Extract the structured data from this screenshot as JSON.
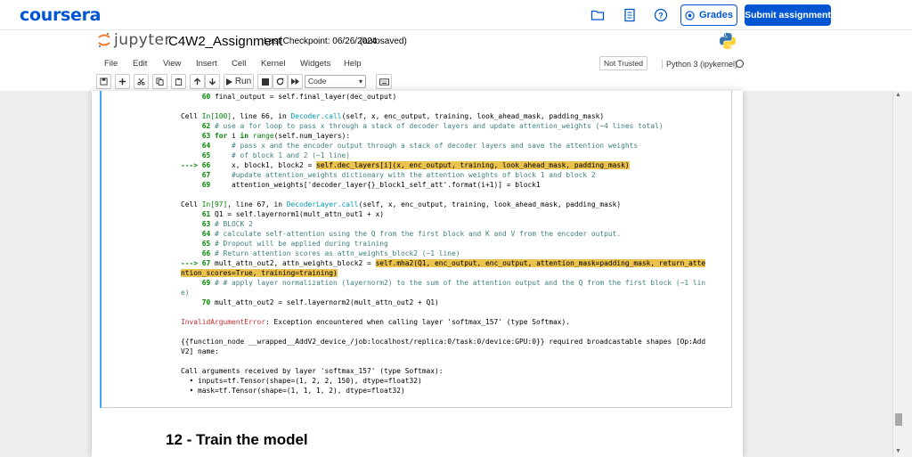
{
  "coursera": {
    "logo": "coursera",
    "grades_label": "Grades",
    "submit_label": "Submit assignment",
    "brand_color": "#0056d2"
  },
  "jupyter": {
    "logo_text": "jupyter",
    "notebook_title": "C4W2_Assignment",
    "checkpoint": "Last Checkpoint: 06/26/2024",
    "autosave": "(autosaved)",
    "menu": [
      "File",
      "Edit",
      "View",
      "Insert",
      "Cell",
      "Kernel",
      "Widgets",
      "Help"
    ],
    "trust_status": "Not Trusted",
    "kernel": "Python 3 (ipykernel)",
    "toolbar": {
      "run_label": "Run",
      "cell_type": "Code"
    }
  },
  "traceback": {
    "lines": [
      {
        "no": "60",
        "code": "final_output = self.final_layer(dec_output)"
      },
      {
        "blank": true
      },
      {
        "header": "Cell In[100], line 66, in Decoder.call(self, x, enc_output, training, look_ahead_mask, padding_mask)"
      },
      {
        "no": "62",
        "code": "# use a for loop to pass x through a stack of decoder layers and update attention_weights (~4 lines total)"
      },
      {
        "no": "63",
        "code": "for i in range(self.num_layers):"
      },
      {
        "no": "64",
        "code": "    # pass x and the encoder output through a stack of decoder layers and save the attention weights"
      },
      {
        "no": "65",
        "code": "    # of block 1 and 2 (~1 line)"
      },
      {
        "arrow": "---> 66",
        "code_pre": "    x, block1, block2 = ",
        "code_hl": "self.dec_layers[i](x, enc_output, training, look_ahead_mask, padding_mask)"
      },
      {
        "no": "67",
        "code": "    #update attention_weights dictionary with the attention weights of block 1 and block 2"
      },
      {
        "no": "69",
        "code": "    attention_weights['decoder_layer{}_block1_self_att'.format(i+1)] = block1"
      },
      {
        "blank": true
      },
      {
        "header": "Cell In[97], line 67, in DecoderLayer.call(self, x, enc_output, training, look_ahead_mask, padding_mask)"
      },
      {
        "no": "61",
        "code": "Q1 = self.layernorm1(mult_attn_out1 + x)"
      },
      {
        "no": "63",
        "code": "# BLOCK 2"
      },
      {
        "no": "64",
        "code": "# calculate self-attention using the Q from the first block and K and V from the encoder output."
      },
      {
        "no": "65",
        "code": "# Dropout will be applied during training"
      },
      {
        "no": "66",
        "code": "# Return attention scores as attn_weights_block2 (~1 line)"
      },
      {
        "arrow2": "---> 67",
        "code_pre": " mult_attn_out2, attn_weights_block2 = ",
        "code_hl": "self.mha2(Q1, enc_output, enc_output, attention_mask=padding_mask, return_atte",
        "code_hl2": "ntion_scores=True, training=training)"
      },
      {
        "no": "69",
        "code": "# # apply layer normalization (layernorm2) to the sum of the attention output and the Q from the first block (~1 lin",
        "code2": "e)"
      },
      {
        "no": "70",
        "code": "mult_attn_out2 = self.layernorm2(mult_attn_out2 + Q1)"
      },
      {
        "blank": true
      },
      {
        "error_name": "InvalidArgumentError",
        "error_msg": ": Exception encountered when calling layer 'softmax_157' (type Softmax)."
      },
      {
        "blank": true
      },
      {
        "plain": "{{function_node __wrapped__AddV2_device_/job:localhost/replica:0/task:0/device:GPU:0}} required broadcastable shapes [Op:Add"
      },
      {
        "plain": "V2] name: "
      },
      {
        "blank": true
      },
      {
        "plain": "Call arguments received by layer 'softmax_157' (type Softmax):"
      },
      {
        "plain": "  • inputs=tf.Tensor(shape=(1, 2, 2, 150), dtype=float32)"
      },
      {
        "plain": "  • mask=tf.Tensor(shape=(1, 1, 1, 2), dtype=float32)"
      }
    ]
  },
  "next_section": "12 - Train the model"
}
